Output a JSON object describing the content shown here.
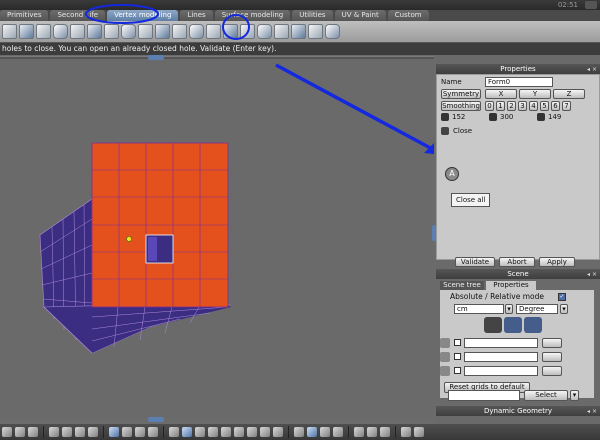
{
  "window": {
    "clock": "02:51"
  },
  "tabs": [
    {
      "label": "Primitives",
      "active": false
    },
    {
      "label": "Second Life",
      "active": false
    },
    {
      "label": "Vertex modeling",
      "active": true
    },
    {
      "label": "Lines",
      "active": false
    },
    {
      "label": "Surface modeling",
      "active": false
    },
    {
      "label": "Utilities",
      "active": false
    },
    {
      "label": "UV & Paint",
      "active": false
    },
    {
      "label": "Custom",
      "active": false
    }
  ],
  "hint": "holes to close. You can open an already closed hole. Validate (Enter key).",
  "properties": {
    "title": "Properties",
    "name_label": "Name",
    "name_value": "Form0",
    "symmetry_label": "Symmetry",
    "axes": [
      "X",
      "Y",
      "Z"
    ],
    "smoothing_label": "Smoothing",
    "smoothing_levels": [
      "0",
      "1",
      "2",
      "3",
      "4",
      "5",
      "6",
      "7"
    ],
    "stats": [
      "152",
      "300",
      "149"
    ],
    "close_label": "Close",
    "tooltip": "Close all",
    "buttons": {
      "validate": "Validate",
      "abort": "Abort",
      "apply": "Apply"
    }
  },
  "scene": {
    "title": "Scene",
    "tabs": [
      "Scene tree",
      "Properties"
    ],
    "active_tab": "Properties",
    "mode_label": "Absolute / Relative mode",
    "mode_checked": true,
    "unit": "cm",
    "angle_unit": "Degree",
    "reset_button": "Reset grids to default",
    "select_button": "Select"
  },
  "dynamic_geometry": {
    "title": "Dynamic Geometry"
  },
  "colors": {
    "annotation": "#1428e0",
    "cube_front": "#e4511c",
    "cube_side": "#3a2d82",
    "accent_tab": "#5e7ea5"
  }
}
